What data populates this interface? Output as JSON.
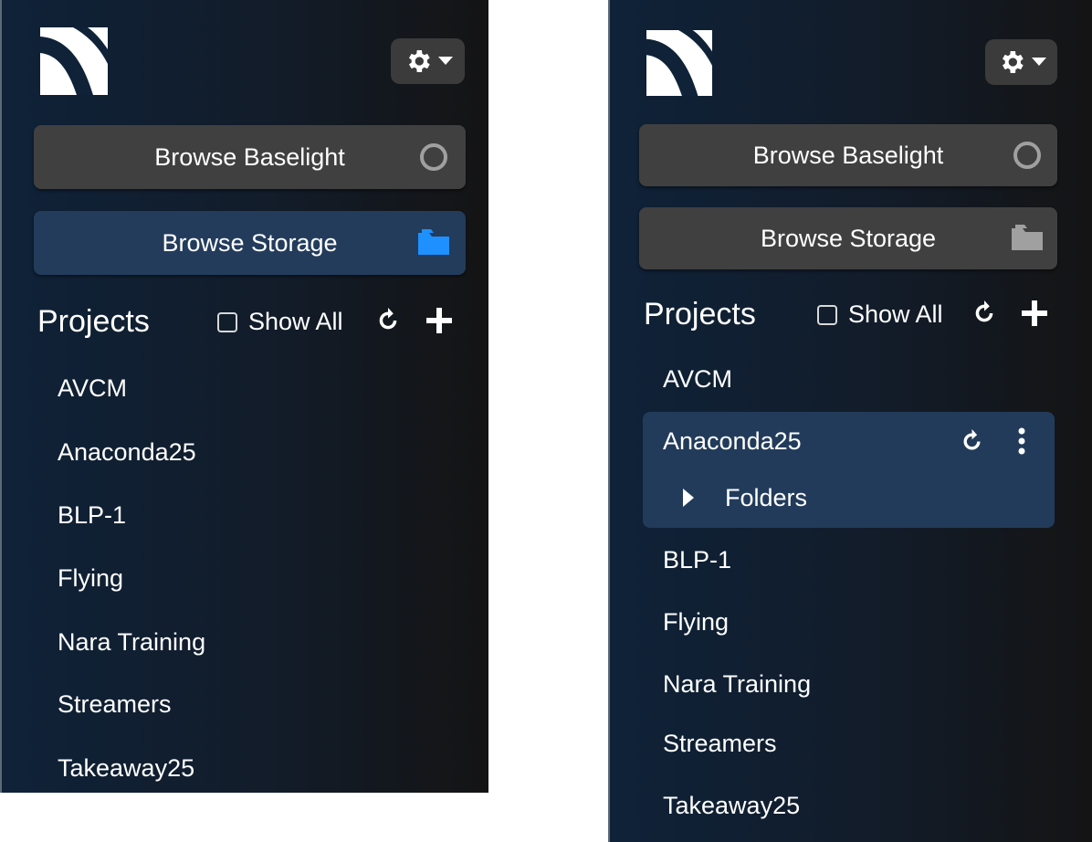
{
  "panels": {
    "left": {
      "browse_baselight": "Browse Baselight",
      "browse_storage": "Browse Storage",
      "projects_title": "Projects",
      "show_all": "Show All",
      "projects": [
        "AVCM",
        "Anaconda25",
        "BLP-1",
        "Flying",
        "Nara Training",
        "Streamers",
        "Takeaway25"
      ]
    },
    "right": {
      "browse_baselight": "Browse Baselight",
      "browse_storage": "Browse Storage",
      "projects_title": "Projects",
      "show_all": "Show All",
      "projects": [
        "AVCM",
        "Anaconda25",
        "BLP-1",
        "Flying",
        "Nara Training",
        "Streamers",
        "Takeaway25"
      ],
      "selected_project_child": "Folders"
    }
  },
  "icons": {
    "logo": "logo-icon",
    "settings": "gear-icon",
    "settings_menu": "caret-down-icon",
    "baselight": "circle-icon",
    "storage": "folder-icon",
    "refresh": "refresh-icon",
    "add": "plus-icon",
    "more": "more-vertical-icon",
    "expand": "caret-right-icon"
  },
  "colors": {
    "active_button": "#233c5c",
    "inactive_button": "#404040",
    "storage_icon_active": "#1e90ff",
    "storage_icon_inactive": "#a0a0a0",
    "selected_row": "#223b5a"
  }
}
